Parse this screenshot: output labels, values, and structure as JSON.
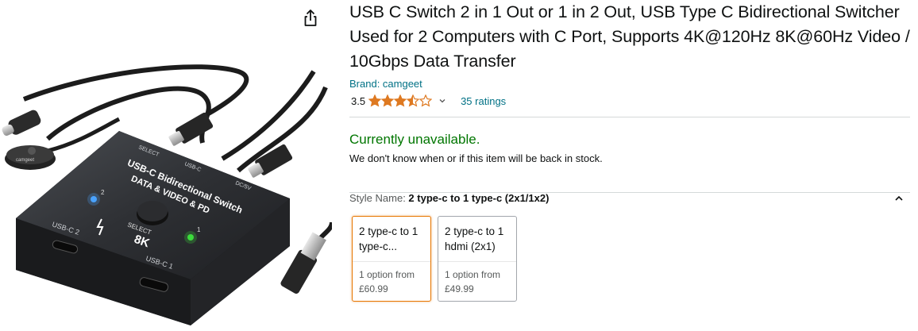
{
  "product": {
    "title": "USB C Switch 2 in 1 Out or 1 in 2 Out, USB Type C Bidirectional Switcher Used for 2 Computers with C Port, Supports 4K@120Hz 8K@60Hz Video / 10Gbps Data Transfer",
    "brand": "Brand: camgeet",
    "rating_value": "3.5",
    "rating_stars": 3.5,
    "ratings_count": "35 ratings",
    "availability": "Currently unavailable.",
    "stock_note": "We don't know when or if this item will be back in stock."
  },
  "image": {
    "device_top_label": "USB-C Bidirectional Switch",
    "device_sub_label": "DATA & VIDEO & PD",
    "select_top": "SELECT",
    "usbc_top": "USB-C",
    "dc_label": "DC/5V",
    "select_button_label": "SELECT",
    "led2": "2",
    "led1": "1",
    "port2_label": "USB-C 2",
    "port1_label": "USB-C 1",
    "badge_8k": "8K",
    "remote_brand": "camgeet"
  },
  "style": {
    "label": "Style Name: ",
    "value": "2 type-c to 1 type-c (2x1/1x2)",
    "options": [
      {
        "line1": "2 type-c to 1",
        "line2": "type-c...",
        "option_text": "1 option from",
        "price": "£60.99",
        "selected": true
      },
      {
        "line1": "2 type-c to 1",
        "line2": "hdmi (2x1)",
        "option_text": "1 option from",
        "price": "£49.99",
        "selected": false
      }
    ]
  },
  "colors": {
    "link": "#007185",
    "available_green": "#007600",
    "star": "#de7921",
    "selected_border": "#e77600"
  },
  "icons": [
    "share-icon",
    "star-icon",
    "chevron-down-icon",
    "chevron-up-icon"
  ]
}
